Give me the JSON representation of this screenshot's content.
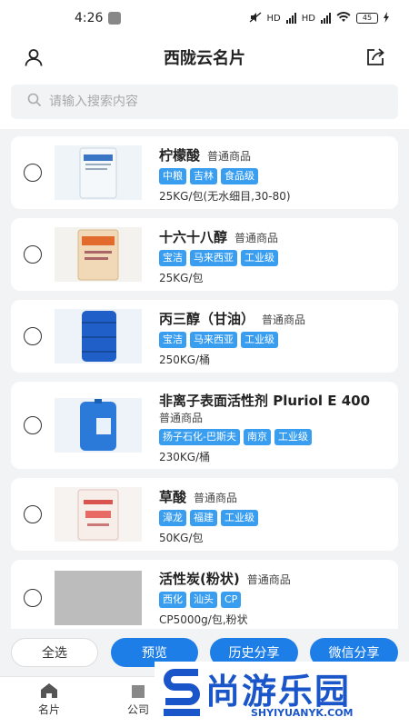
{
  "status_bar": {
    "time": "4:26",
    "battery": "45",
    "net1": "HD",
    "net2": "HD"
  },
  "header": {
    "title": "西陇云名片",
    "left_icon": "user-icon",
    "right_icon": "share-export-icon"
  },
  "search": {
    "placeholder": "请输入搜索内容"
  },
  "products": [
    {
      "name": "柠檬酸",
      "type": "普通商品",
      "tags": [
        "中粮",
        "吉林",
        "食品级"
      ],
      "spec": "25KG/包(无水细目,30-80)"
    },
    {
      "name": "十六十八醇",
      "type": "普通商品",
      "tags": [
        "宝洁",
        "马来西亚",
        "工业级"
      ],
      "spec": "25KG/包"
    },
    {
      "name": "丙三醇（甘油）",
      "type": "普通商品",
      "tags": [
        "宝洁",
        "马来西亚",
        "工业级"
      ],
      "spec": "250KG/桶"
    },
    {
      "name": "非离子表面活性剂 Pluriol E 400",
      "type": "普通商品",
      "tags": [
        "扬子石化-巴斯夫",
        "南京",
        "工业级"
      ],
      "spec": "230KG/桶"
    },
    {
      "name": "草酸",
      "type": "普通商品",
      "tags": [
        "漳龙",
        "福建",
        "工业级"
      ],
      "spec": "50KG/包"
    },
    {
      "name": "活性炭(粉状)",
      "type": "普通商品",
      "tags": [
        "西化",
        "汕头",
        "CP"
      ],
      "spec": "CP5000g/包,粉状"
    }
  ],
  "actions": {
    "select_all": "全选",
    "preview": "预览",
    "history_share": "历史分享",
    "wechat_share": "微信分享"
  },
  "tabbar": {
    "tab1": "名片",
    "tab2": "公司"
  },
  "watermark": {
    "text": "尚游乐园",
    "url": "SHYIYUANYK.COM"
  }
}
